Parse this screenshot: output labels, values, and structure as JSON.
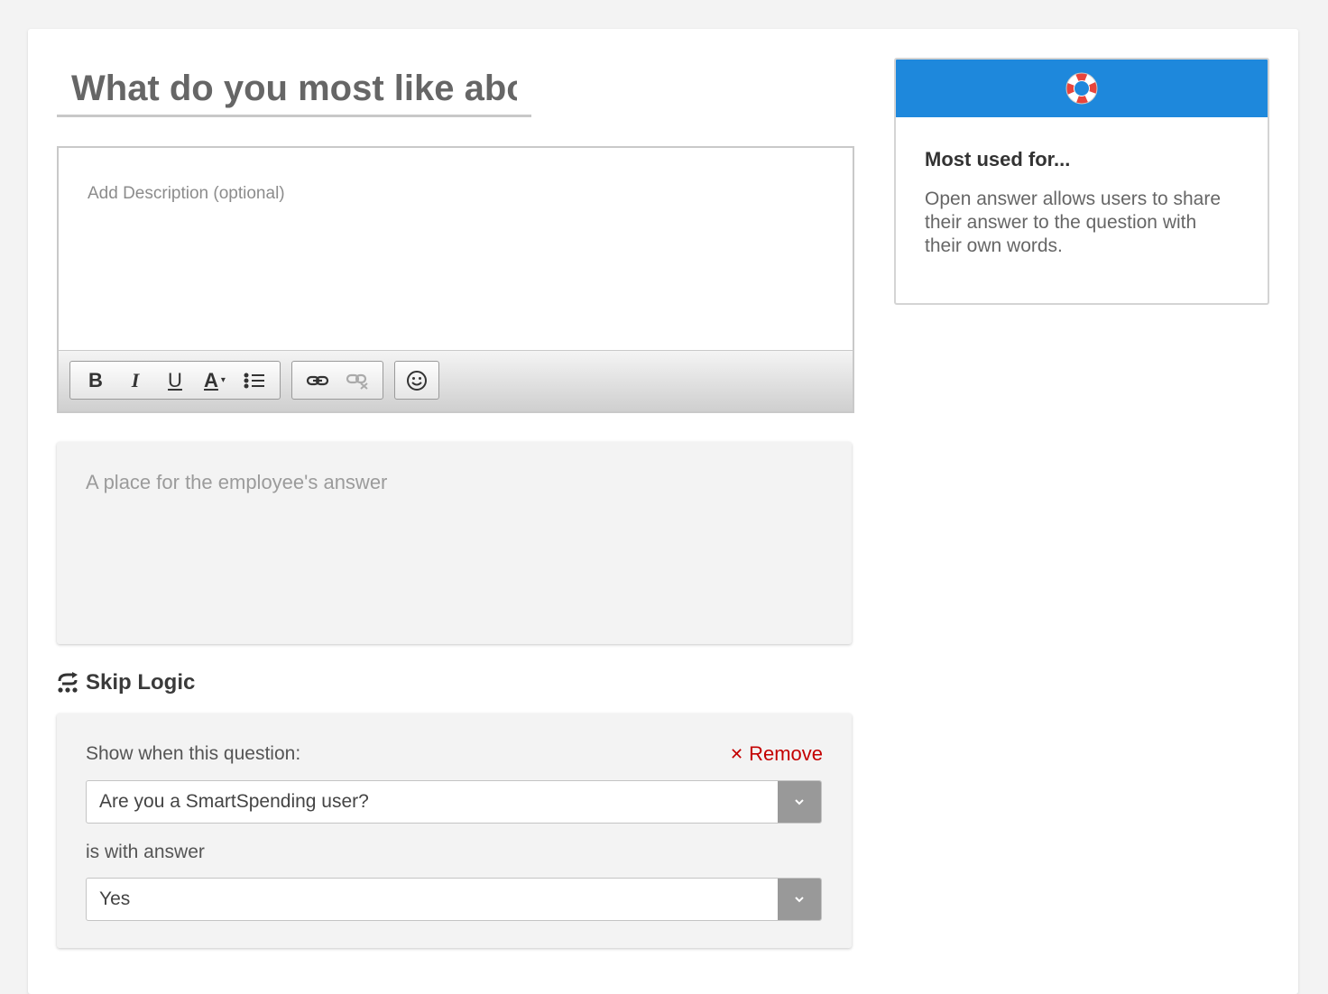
{
  "question": {
    "title": "What do you most like about"
  },
  "editor": {
    "placeholder": "Add Description (optional)",
    "toolbar": {
      "bold": "B",
      "italic": "I",
      "underline": "U",
      "font_color": "A"
    }
  },
  "answer": {
    "placeholder": "A place for the employee's answer"
  },
  "skip_logic": {
    "heading": "Skip Logic",
    "show_when_label": "Show when this question:",
    "remove_label": "Remove",
    "question_select": "Are you a SmartSpending user?",
    "answer_label": "is with answer",
    "answer_select": "Yes"
  },
  "help": {
    "title": "Most used for...",
    "text": "Open answer allows users to share their answer to the question with their own words.",
    "icon": "lifebuoy-icon",
    "header_color": "#1e88dc"
  },
  "colors": {
    "remove": "#c40000",
    "accent": "#1e88dc"
  }
}
